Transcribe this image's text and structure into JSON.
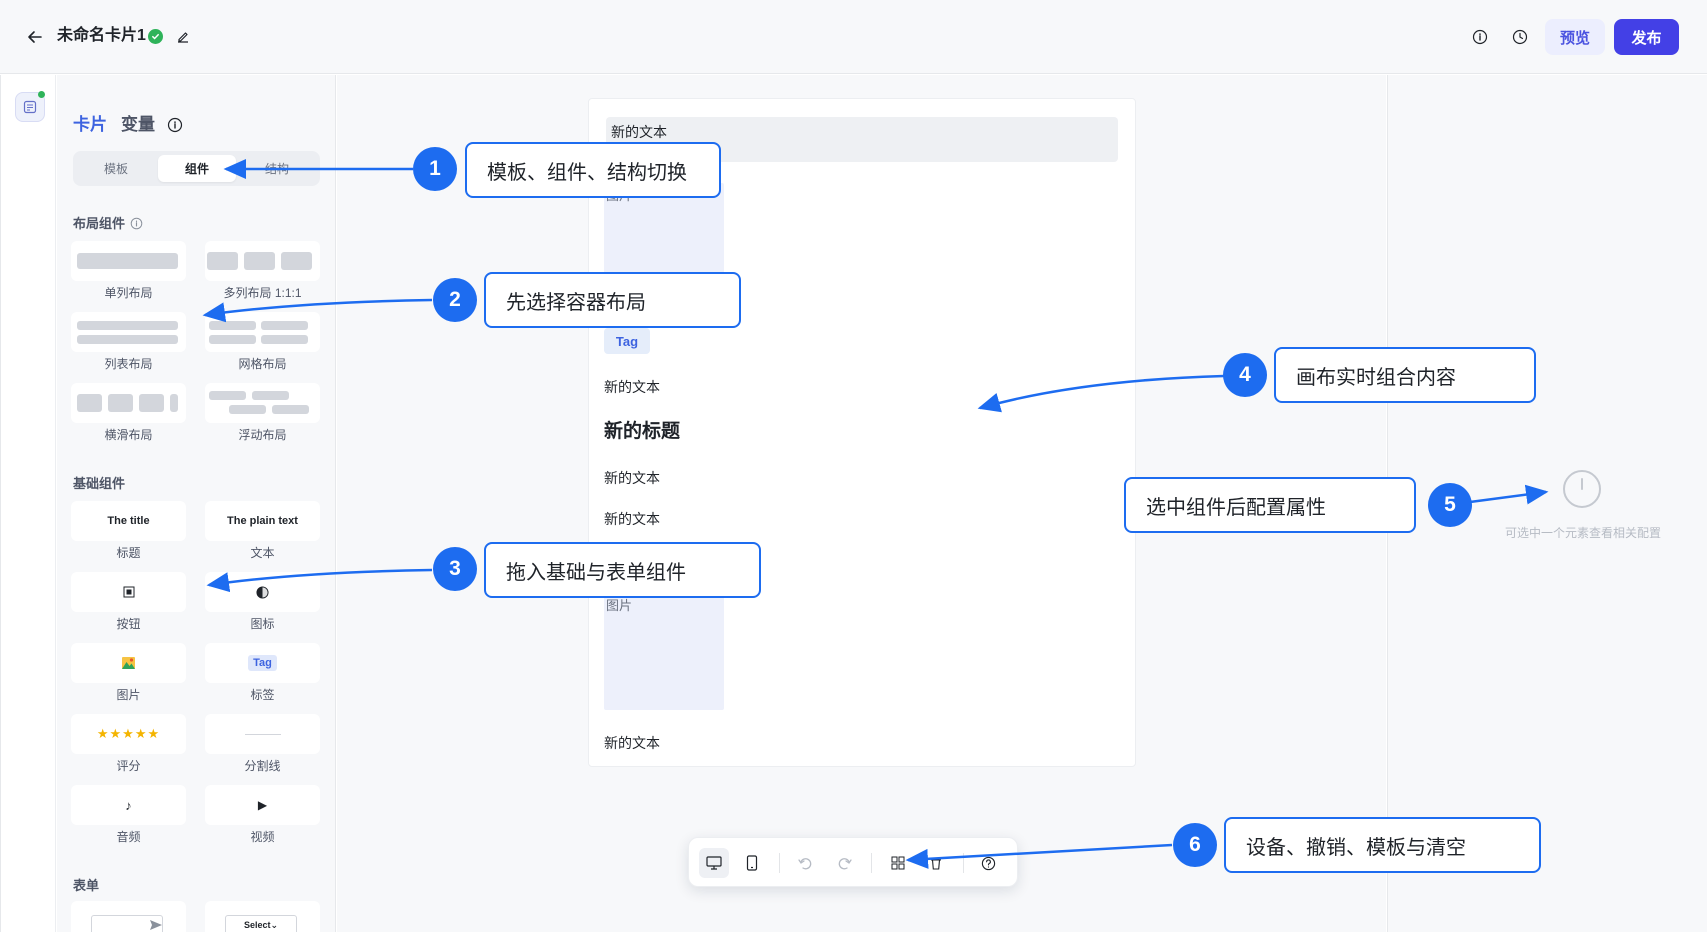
{
  "header": {
    "title": "未命名卡片1",
    "preview_label": "预览",
    "publish_label": "发布"
  },
  "panel": {
    "tabs": [
      "卡片",
      "变量"
    ],
    "segments": [
      "模板",
      "组件",
      "结构"
    ],
    "layout_section": "布局组件",
    "layouts": [
      "单列布局",
      "多列布局 1:1:1",
      "列表布局",
      "网格布局",
      "横滑布局",
      "浮动布局"
    ],
    "basic_section": "基础组件",
    "basic": [
      "标题",
      "文本",
      "按钮",
      "图标",
      "图片",
      "标签",
      "评分",
      "分割线",
      "音频",
      "视频"
    ],
    "basic_previews": {
      "title": "The title",
      "plain": "The plain text",
      "tag": "Tag",
      "rating": "★★★★★",
      "audio": "♪",
      "video": "▶"
    },
    "form_section": "表单",
    "form_select": "Select⌄"
  },
  "canvas": {
    "text_highlight": "新的文本",
    "image_alt": "图片",
    "tag": "Tag",
    "texts": [
      "新的文本",
      "新的文本",
      "新的文本",
      "新的文本"
    ],
    "heading": "新的标题"
  },
  "right_panel": {
    "empty_text": "可选中一个元素查看相关配置"
  },
  "annotations": [
    {
      "num": "1",
      "text": "模板、组件、结构切换"
    },
    {
      "num": "2",
      "text": "先选择容器布局"
    },
    {
      "num": "3",
      "text": "拖入基础与表单组件"
    },
    {
      "num": "4",
      "text": "画布实时组合内容"
    },
    {
      "num": "5",
      "text": "选中组件后配置属性"
    },
    {
      "num": "6",
      "text": "设备、撤销、模板与清空"
    }
  ],
  "colors": {
    "accent": "#3d63e0",
    "publish": "#4340e6",
    "annotation": "#1d6cf0",
    "success": "#2fb35a"
  }
}
